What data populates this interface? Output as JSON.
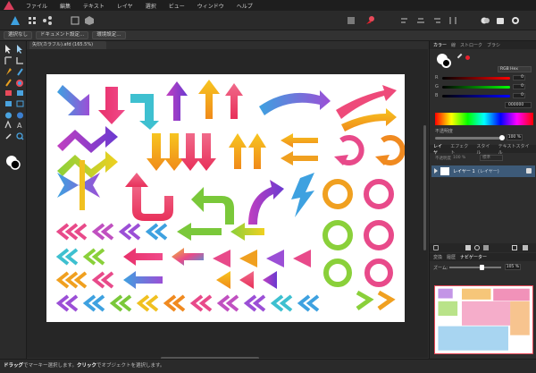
{
  "menu": {
    "items": [
      "ファイル",
      "編集",
      "テキスト",
      "レイヤ",
      "選択",
      "ビュー",
      "ウィンドウ",
      "ヘルプ"
    ]
  },
  "context": {
    "btn1": "選択なし",
    "btn2": "ドキュメント設定...",
    "btn3": "環境設定..."
  },
  "document": {
    "tab_title": "矢印(カラフル).afd (165.5%)"
  },
  "color_panel": {
    "tabs": [
      "カラー",
      "線",
      "ストローク",
      "ブラシ"
    ],
    "mode": "RGB Hex",
    "r_value": "0",
    "g_value": "0",
    "b_value": "0",
    "hex_value": "000000",
    "opacity_label": "不透明度",
    "opacity_value": "100 %"
  },
  "layers_panel": {
    "tabs": [
      "レイヤ",
      "エフェクト",
      "スタイル",
      "テキストスタイル"
    ],
    "opacity_label": "不透明度",
    "opacity_value": "100 %",
    "blend_mode": "標準",
    "layer_name": "レイヤー 1",
    "layer_type": "(レイヤー)"
  },
  "navigator_panel": {
    "tabs": [
      "変換",
      "履歴",
      "ナビゲーター"
    ],
    "zoom_label": "ズーム:",
    "zoom_value": "105 %"
  },
  "status": {
    "drag": "ドラッグ",
    "text1": "でマーキー選択します。",
    "click": "クリック",
    "text2": "でオブジェクトを選択します。"
  },
  "colors": {
    "accent": "#4aa3df",
    "fill_color": "#e8202c",
    "stroke_color": "#ffffff"
  }
}
